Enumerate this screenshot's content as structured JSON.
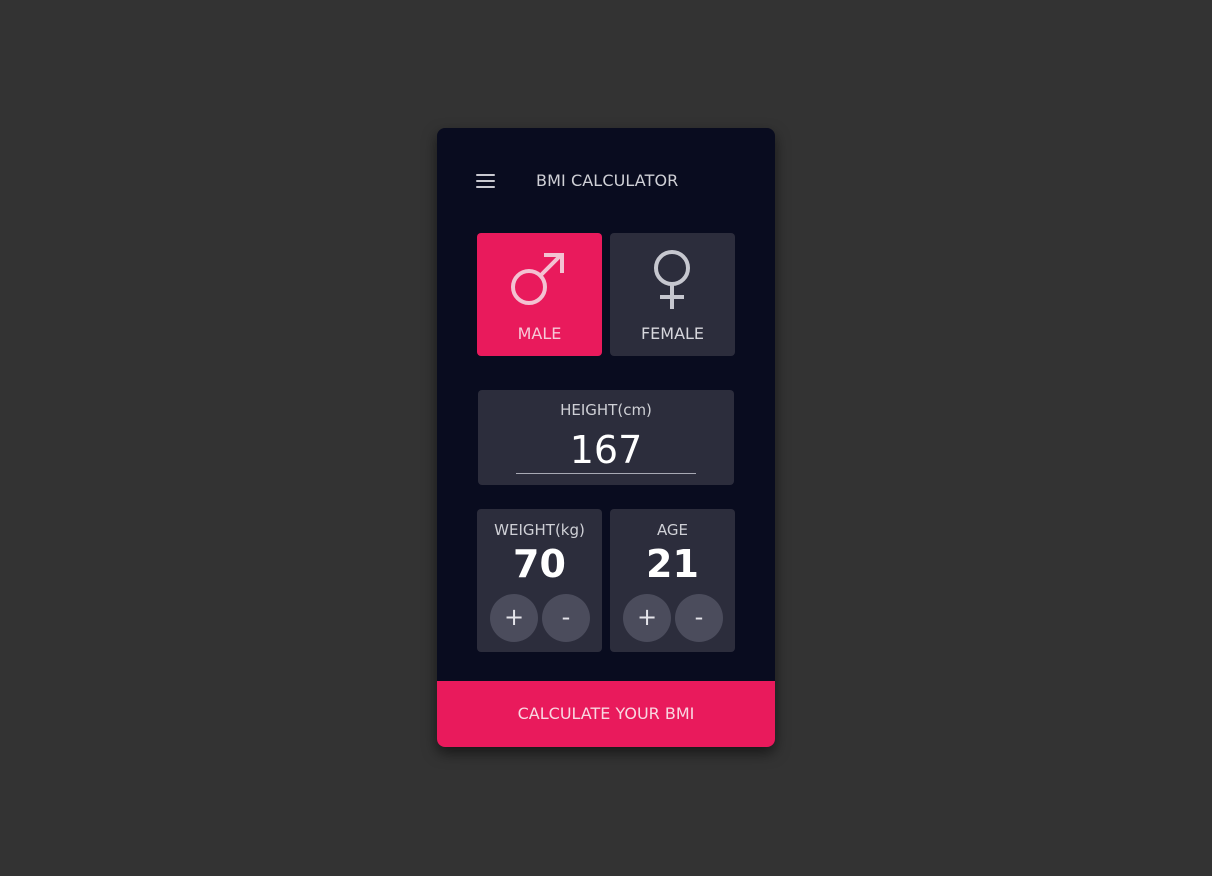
{
  "header": {
    "menu_icon": "hamburger-menu-icon",
    "title": "BMI CALCULATOR"
  },
  "gender": {
    "selected": "male",
    "male": {
      "label": "MALE",
      "icon": "male-symbol-icon"
    },
    "female": {
      "label": "FEMALE",
      "icon": "female-symbol-icon"
    }
  },
  "height": {
    "label": "HEIGHT(cm)",
    "value": "167"
  },
  "weight": {
    "label": "WEIGHT(kg)",
    "value": "70",
    "plus_label": "+",
    "minus_label": "-"
  },
  "age": {
    "label": "AGE",
    "value": "21",
    "plus_label": "+",
    "minus_label": "-"
  },
  "calculate_button": {
    "label": "CALCULATE YOUR BMI"
  },
  "colors": {
    "accent": "#e91a5c",
    "card": "#2c2d3c",
    "panel": "#090c1f",
    "background": "#333333"
  }
}
